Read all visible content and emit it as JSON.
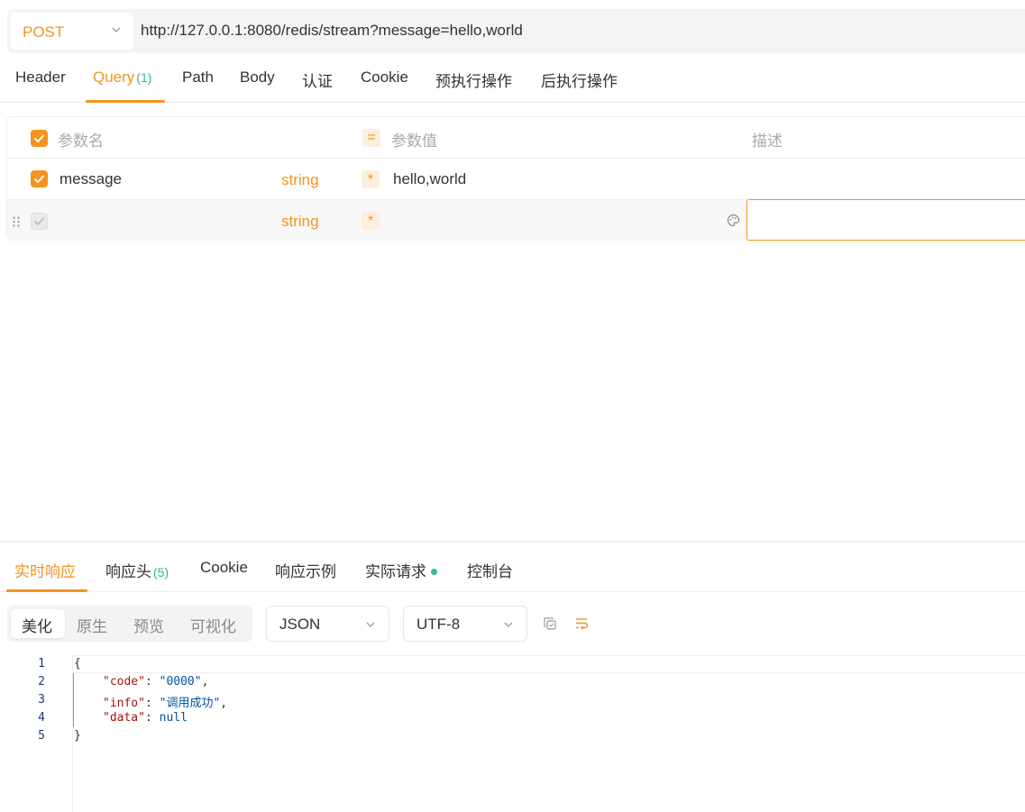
{
  "request": {
    "method": "POST",
    "url": "http://127.0.0.1:8080/redis/stream?message=hello,world"
  },
  "req_tabs": [
    {
      "label": "Header"
    },
    {
      "label": "Query",
      "count": "(1)",
      "active": true
    },
    {
      "label": "Path"
    },
    {
      "label": "Body"
    },
    {
      "label": "认证"
    },
    {
      "label": "Cookie"
    },
    {
      "label": "预执行操作"
    },
    {
      "label": "后执行操作"
    }
  ],
  "params": {
    "headers": {
      "name": "参数名",
      "eq": "=",
      "value": "参数值",
      "desc": "描述"
    },
    "rows": [
      {
        "name": "message",
        "type": "string",
        "required": "*",
        "value": "hello,world",
        "checked": true
      },
      {
        "name": "",
        "type": "string",
        "required": "*",
        "value": "",
        "checked": false
      }
    ]
  },
  "res_tabs": [
    {
      "label": "实时响应",
      "active": true
    },
    {
      "label": "响应头",
      "count": "(5)"
    },
    {
      "label": "Cookie"
    },
    {
      "label": "响应示例"
    },
    {
      "label": "实际请求",
      "dot": true
    },
    {
      "label": "控制台"
    }
  ],
  "view": {
    "modes": [
      "美化",
      "原生",
      "预览",
      "可视化"
    ],
    "format": "JSON",
    "encoding": "UTF-8"
  },
  "code": {
    "line_numbers": [
      "1",
      "2",
      "3",
      "4",
      "5"
    ],
    "open": "{",
    "close": "}",
    "fields": [
      {
        "key": "\"code\"",
        "value": "\"0000\"",
        "comma": ","
      },
      {
        "key": "\"info\"",
        "value": "\"调用成功\"",
        "comma": ","
      },
      {
        "key": "\"data\"",
        "value": "null",
        "comma": ""
      }
    ]
  },
  "colors": {
    "accent": "#f5931f",
    "count": "#2fb892",
    "status_dot": "#2fc28f"
  }
}
